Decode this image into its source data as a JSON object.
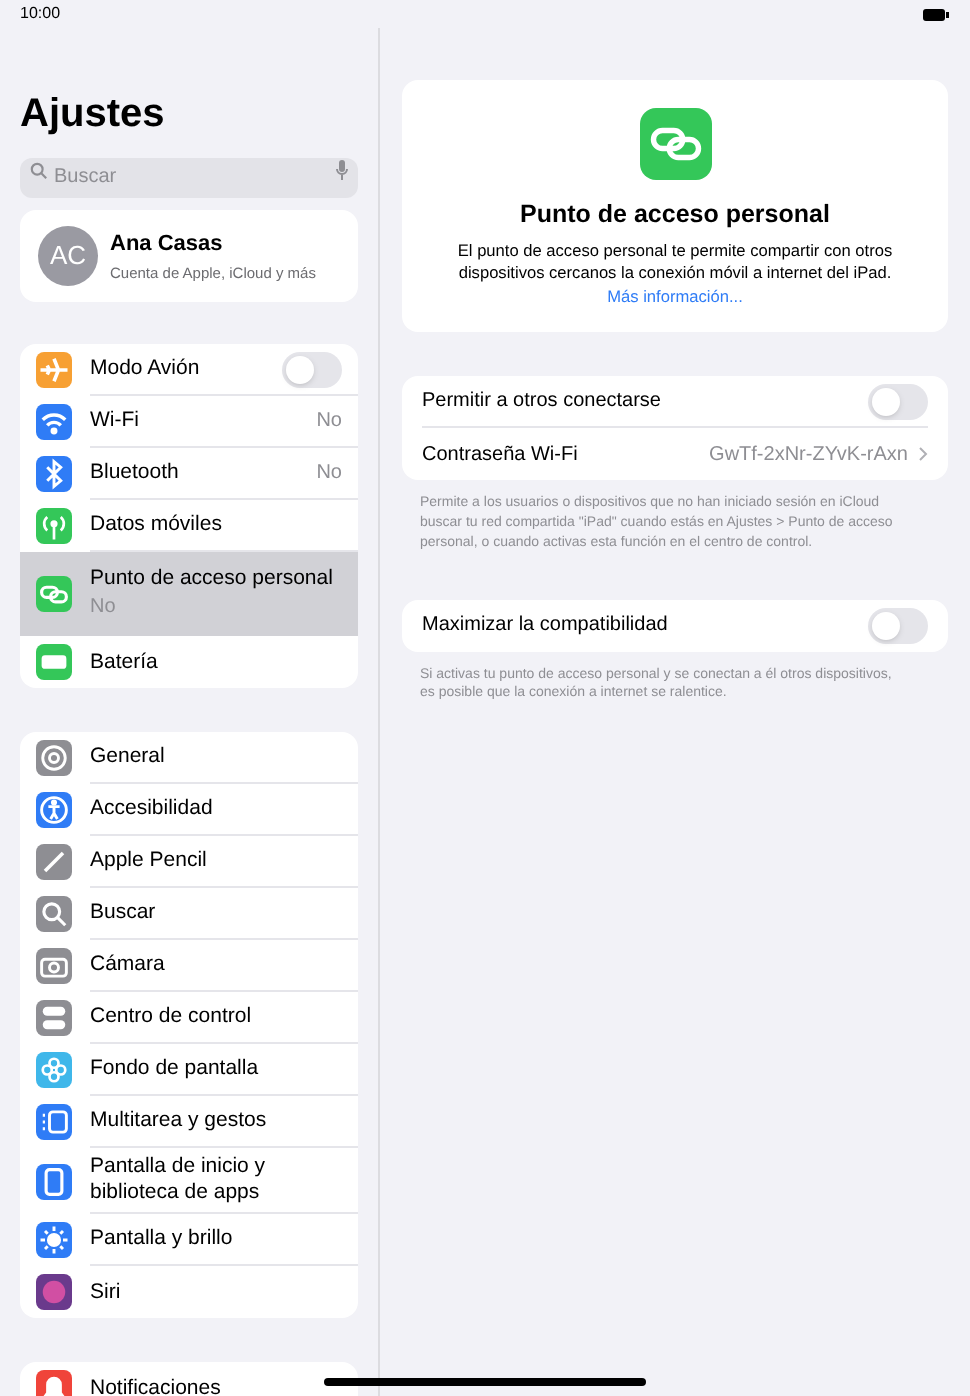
{
  "status_bar": {
    "time": "10:00"
  },
  "sidebar": {
    "title": "Ajustes",
    "search": {
      "placeholder": "Buscar"
    },
    "profile": {
      "initials": "AC",
      "name": "Ana Casas",
      "subtitle": "Cuenta de Apple, iCloud y más"
    },
    "groups": [
      [
        {
          "label": "Modo Avión",
          "kind": "toggle",
          "on": false,
          "selected": false,
          "color": "#f7a033"
        },
        {
          "label": "Wi-Fi",
          "kind": "value",
          "value": "No",
          "selected": false,
          "color": "#2f7cf6"
        },
        {
          "label": "Bluetooth",
          "kind": "value",
          "value": "No",
          "selected": false,
          "color": "#2f7cf6"
        },
        {
          "label": "Datos móviles",
          "kind": "plain",
          "selected": false,
          "color": "#34c759"
        },
        {
          "label": "Punto de acceso personal",
          "kind": "subtitle",
          "value": "No",
          "selected": true,
          "color": "#34c759"
        },
        {
          "label": "Batería",
          "kind": "plain",
          "selected": false,
          "color": "#34c759"
        }
      ],
      [
        {
          "label": "General",
          "kind": "plain",
          "selected": false,
          "color": "#8e8e93"
        },
        {
          "label": "Accesibilidad",
          "kind": "plain",
          "selected": false,
          "color": "#2f7cf6"
        },
        {
          "label": "Apple Pencil",
          "kind": "plain",
          "selected": false,
          "color": "#8e8e93"
        },
        {
          "label": "Buscar",
          "kind": "plain",
          "selected": false,
          "color": "#8e8e93"
        },
        {
          "label": "Cámara",
          "kind": "plain",
          "selected": false,
          "color": "#8e8e93"
        },
        {
          "label": "Centro de control",
          "kind": "plain",
          "selected": false,
          "color": "#8e8e93"
        },
        {
          "label": "Fondo de pantalla",
          "kind": "plain",
          "selected": false,
          "color": "#3fb7ea"
        },
        {
          "label": "Multitarea y gestos",
          "kind": "plain",
          "selected": false,
          "color": "#2f7cf6"
        },
        {
          "label": "Pantalla de inicio y biblioteca de apps",
          "kind": "plain",
          "selected": false,
          "color": "#2f7cf6"
        },
        {
          "label": "Pantalla y brillo",
          "kind": "plain",
          "selected": false,
          "color": "#2f7cf6"
        },
        {
          "label": "Siri",
          "kind": "plain",
          "selected": false,
          "color": "#6a3a8c"
        }
      ],
      [
        {
          "label": "Notificaciones",
          "kind": "plain",
          "selected": false,
          "color": "#f0443a"
        }
      ]
    ]
  },
  "detail": {
    "hero": {
      "title": "Punto de acceso personal",
      "description": "El punto de acceso personal te permite compartir con otros dispositivos cercanos la conexión móvil a internet del iPad.",
      "link": "Más información..."
    },
    "sections": [
      {
        "rows": [
          {
            "label": "Permitir a otros conectarse",
            "kind": "toggle",
            "on": false
          },
          {
            "label": "Contraseña Wi-Fi",
            "kind": "value",
            "value": "GwTf-2xNr-ZYvK-rAxn"
          }
        ],
        "footer": "Permite a los usuarios o dispositivos que no han iniciado sesión en iCloud buscar tu red compartida \"iPad\" cuando estás en Ajustes > Punto de acceso personal, o cuando activas esta función en el centro de control."
      },
      {
        "rows": [
          {
            "label": "Maximizar la compatibilidad",
            "kind": "toggle",
            "on": false
          }
        ],
        "footer": "Si activas tu punto de acceso personal y se conectan a él otros dispositivos, es posible que la conexión a internet se ralentice."
      }
    ]
  }
}
